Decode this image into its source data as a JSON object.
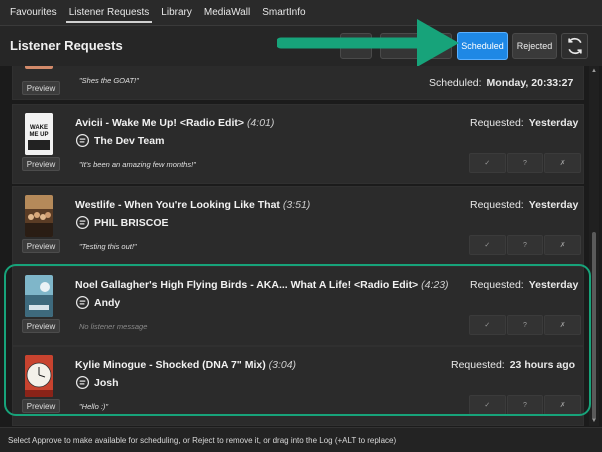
{
  "tabs": [
    "Favourites",
    "Listener Requests",
    "Library",
    "MediaWall",
    "SmartInfo"
  ],
  "active_tab": "Listener Requests",
  "header": {
    "title": "Listener Requests",
    "scheduled_label": "Scheduled",
    "rejected_label": "Rejected"
  },
  "top_partial": {
    "message": "\"Shes the GOAT!\"",
    "preview_label": "Preview",
    "status_label": "Scheduled:",
    "status_value": "Monday, 20:33:27"
  },
  "requests": [
    {
      "song": "Avicii - Wake Me Up! <Radio Edit>",
      "duration": "(4:01)",
      "requested_label": "Requested:",
      "requested_value": "Yesterday",
      "user": "The Dev Team",
      "message": "\"It's been an amazing few months!\"",
      "preview_label": "Preview",
      "thumb": "avicii-cover"
    },
    {
      "song": "Westlife - When You're Looking Like That",
      "duration": "(3:51)",
      "requested_label": "Requested:",
      "requested_value": "Yesterday",
      "user": "PHIL BRISCOE",
      "message": "\"Testing this out!\"",
      "preview_label": "Preview",
      "thumb": "westlife-cover"
    },
    {
      "song": "Noel Gallagher's High Flying Birds - AKA... What A Life! <Radio Edit>",
      "duration": "(4:23)",
      "requested_label": "Requested:",
      "requested_value": "Yesterday",
      "user": "Andy",
      "message": "No listener message",
      "preview_label": "Preview",
      "thumb": "noel-cover"
    },
    {
      "song": "Kylie Minogue - Shocked (DNA 7\" Mix)",
      "duration": "(3:04)",
      "requested_label": "Requested:",
      "requested_value": "23 hours ago",
      "user": "Josh",
      "message": "\"Hello :)\"",
      "preview_label": "Preview",
      "thumb": "kylie-cover"
    }
  ],
  "action_glyphs": {
    "approve": "✓",
    "unsure": "?",
    "reject": "✗"
  },
  "footer": "Select Approve to make available for scheduling, or Reject to remove it, or drag into the Log (+ALT to replace)",
  "colors": {
    "accent_blue": "#1e88e5",
    "highlight_green": "#17a37a"
  }
}
